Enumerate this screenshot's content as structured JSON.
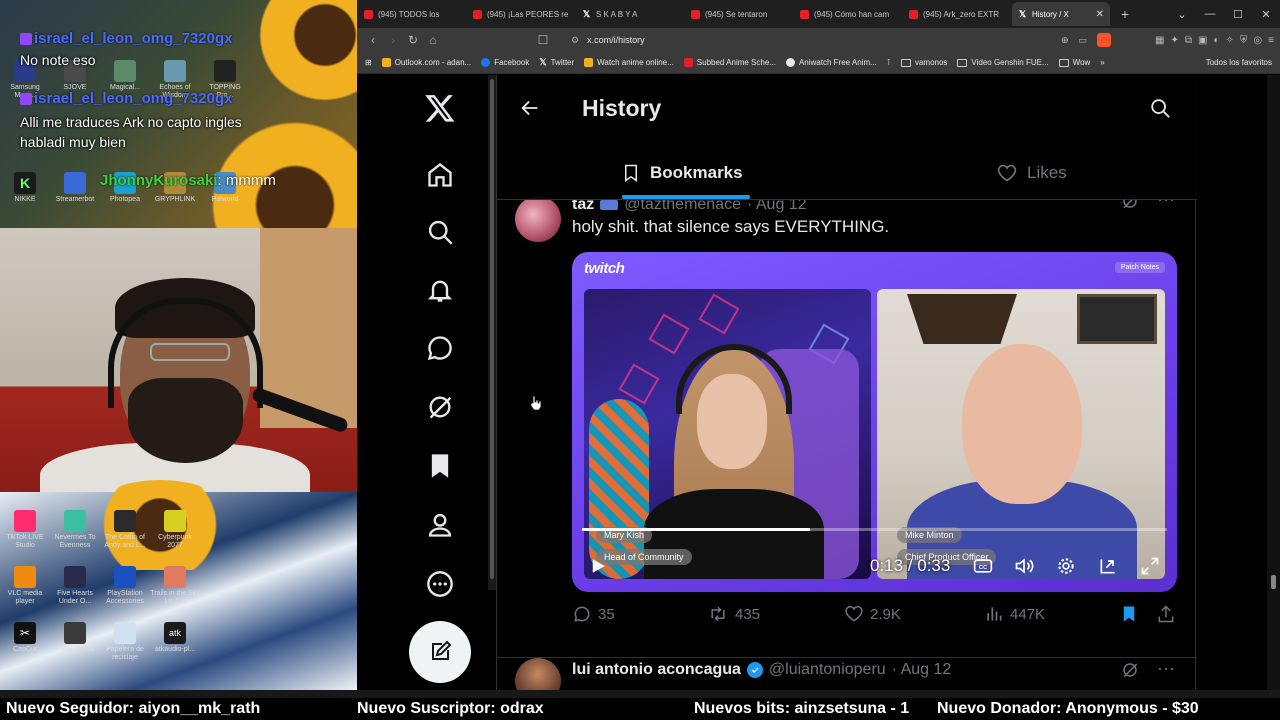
{
  "browser": {
    "tabs": [
      {
        "label": "(945) TODOS los",
        "icon": "youtube-icon"
      },
      {
        "label": "(945) ¡Las PEORES re",
        "icon": "youtube-icon"
      },
      {
        "label": "S K A B Y A",
        "icon": "x-icon"
      },
      {
        "label": "(945) Se tentaron",
        "icon": "youtube-icon"
      },
      {
        "label": "(945) Cómo han cam",
        "icon": "youtube-icon"
      },
      {
        "label": "(945) Ark_zero EXTR",
        "icon": "youtube-icon"
      },
      {
        "label": "History / X",
        "icon": "x-icon",
        "active": true
      }
    ],
    "url": "x.com/i/history",
    "bookmarks": [
      {
        "label": "Outlook.com - adan...",
        "color": "#f0b020"
      },
      {
        "label": "Facebook",
        "color": "#1877f2"
      },
      {
        "label": "Twitter",
        "color": "#000000"
      },
      {
        "label": "Watch anime online...",
        "color": "#f0b020"
      },
      {
        "label": "Subbed Anime Sche...",
        "color": "#e01f2b"
      },
      {
        "label": "Aniwatch Free Anim...",
        "color": "#e7e9ea"
      },
      {
        "label": "vamonos",
        "folder": true
      },
      {
        "label": "Video Genshin FUE...",
        "folder": true
      },
      {
        "label": "Wow",
        "folder": true
      }
    ],
    "bookmarks_right": "Todos los favoritos"
  },
  "x": {
    "page_title": "History",
    "tabs": {
      "bookmarks": "Bookmarks",
      "likes": "Likes"
    },
    "tweet1": {
      "name": "taz",
      "handle": "@tazthemenace",
      "date": "· Aug 12",
      "text": "holy shit. that silence says EVERYTHING.",
      "media": {
        "brand": "twitch",
        "badge": "Patch Notes",
        "left_name": "Mary Kish",
        "left_title": "Head of Community",
        "right_name": "Mike Minton",
        "right_title": "Chief Product Officer",
        "time": "0:13 / 0:33",
        "progress": 0.39
      },
      "replies": "35",
      "reposts": "435",
      "likes": "2.9K",
      "views": "447K"
    },
    "tweet2": {
      "name": "lui antonio aconcagua",
      "handle": "@luiantonioperu",
      "date": "· Aug 12"
    }
  },
  "overlay": {
    "chat": [
      {
        "user": "israel_el_leon_omg_7320gx",
        "message": "No note eso"
      },
      {
        "user": "israel_el_leon_omg_7320gx",
        "message": "Alli me traduces Ark no capto ingles habladi muy bien"
      },
      {
        "user": "JhonnyKurosaki",
        "message": ": mmmm"
      }
    ],
    "desktop_icons": [
      "TikTok LIVE Studio",
      "Nevermes To Evenness",
      "The Coffin of Andy and L...",
      "Cyberpunk 2077",
      "VLC media player",
      "Five Hearts Under O...",
      "PlayStation Accessories",
      "Trails in the Sky 1st C...",
      "CapCut",
      "PRAGMATA",
      "Papelera de reciclaje",
      "atkaudio-pl..."
    ],
    "desktop_icons_top": [
      "Samsung Magi...",
      "SJOVE",
      "Magical...",
      "Echoes of Wisdom",
      "TOPPING Pro...",
      "NIKKE",
      "Streamerbot",
      "Photopea",
      "GRYPHLINK",
      "Palworld"
    ]
  },
  "ticker": {
    "follower": "Nuevo Seguidor: aiyon__mk_rath",
    "subscriber": "Nuevo Suscriptor: odrax",
    "bits": "Nuevos bits: ainzsetsuna - 1",
    "donor": "Nuevo Donador: Anonymous - $30"
  }
}
